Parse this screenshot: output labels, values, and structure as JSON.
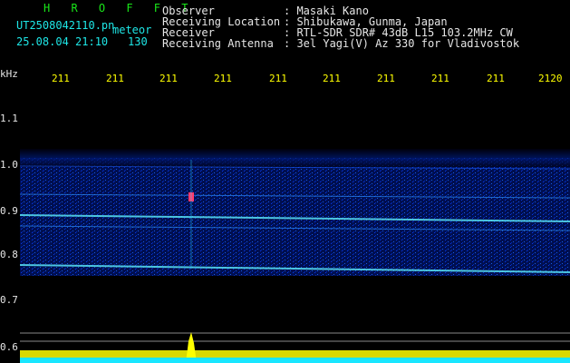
{
  "header": {
    "station": "H R O F F T",
    "filename": "UT2508042110.pn",
    "mode": "meteor",
    "datetime": "25.08.04 21:10",
    "count": "130",
    "fields": [
      {
        "label": "Observer",
        "value": ": Masaki Kano"
      },
      {
        "label": "Receiving Location",
        "value": ": Shibukawa, Gunma, Japan"
      },
      {
        "label": "Receiver",
        "value": ": RTL-SDR SDR# 43dB L15 103.2MHz CW"
      },
      {
        "label": "Receiving Antenna",
        "value": ": 3el Yagi(V) Az 330 for Vladivostok"
      }
    ]
  },
  "axes": {
    "y_unit": "kHz",
    "y_ticks": [
      "1.1",
      "1.0",
      "0.9",
      "0.8",
      "0.7",
      "0.6"
    ],
    "x_ticks": [
      "211",
      "211",
      "211",
      "211",
      "211",
      "211",
      "211",
      "211",
      "211",
      "2120"
    ]
  },
  "colors": {
    "green": "#19e619",
    "cyan": "#1ee6e6",
    "yellow": "#ffff00",
    "bg": "#000000",
    "signal": "#0000ff"
  }
}
